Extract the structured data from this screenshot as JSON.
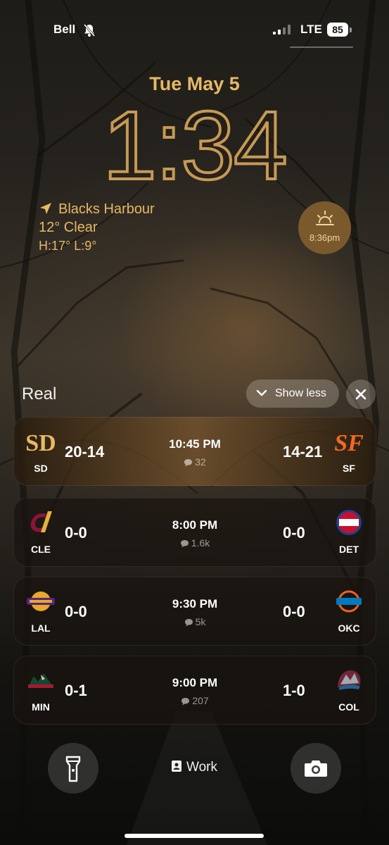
{
  "status_bar": {
    "carrier": "Bell",
    "network": "LTE",
    "battery": "85",
    "silent_icon": "bell-slash-icon",
    "signal_icon": "signal-bars-icon"
  },
  "lock_screen": {
    "date": "Tue May 5",
    "time": "1:34"
  },
  "weather": {
    "location": "Blacks Harbour",
    "condition": "12° Clear",
    "high_low": "H:17° L:9°",
    "sunset_time": "8:36pm",
    "accent_color": "#e8b864"
  },
  "widget": {
    "app_name": "Real",
    "show_less_label": "Show less",
    "games": [
      {
        "away_abbr": "SD",
        "away_record": "20-14",
        "time": "10:45 PM",
        "comments": "32",
        "home_record": "14-21",
        "home_abbr": "SF",
        "highlighted": true
      },
      {
        "away_abbr": "CLE",
        "away_record": "0-0",
        "time": "8:00 PM",
        "comments": "1.6k",
        "home_record": "0-0",
        "home_abbr": "DET"
      },
      {
        "away_abbr": "LAL",
        "away_record": "0-0",
        "time": "9:30 PM",
        "comments": "5k",
        "home_record": "0-0",
        "home_abbr": "OKC"
      },
      {
        "away_abbr": "MIN",
        "away_record": "0-1",
        "time": "9:00 PM",
        "comments": "207",
        "home_record": "1-0",
        "home_abbr": "COL"
      }
    ]
  },
  "bottom_bar": {
    "focus_label": "Work",
    "flashlight_icon": "flashlight-icon",
    "camera_icon": "camera-icon"
  }
}
